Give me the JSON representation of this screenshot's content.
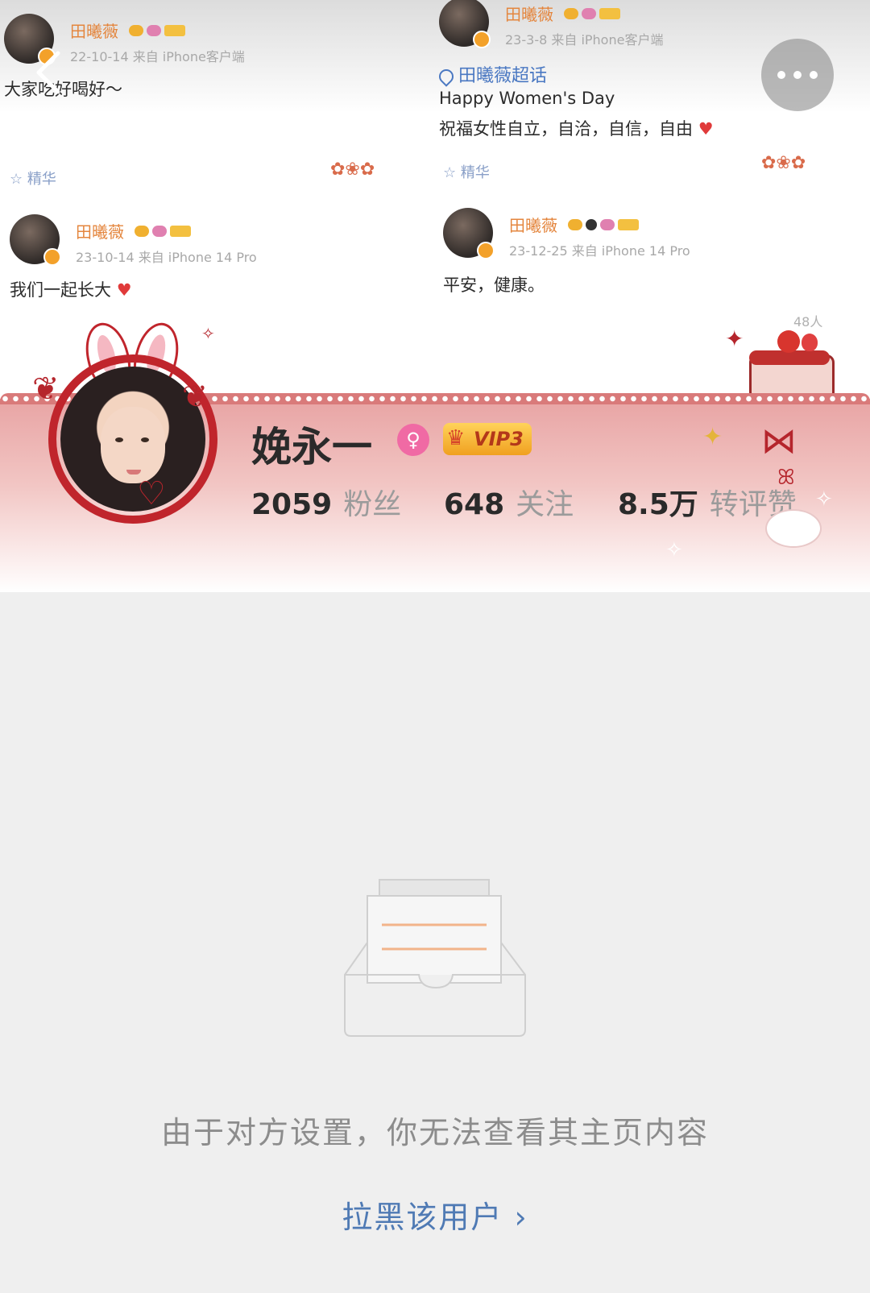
{
  "cover_posts": [
    {
      "name": "田曦薇",
      "meta": "22-10-14  来自 iPhone客户端",
      "text": "大家吃好喝好～",
      "tag": "精华"
    },
    {
      "name": "田曦薇",
      "meta": "23-3-8  来自 iPhone客户端",
      "topic": "田曦薇超话",
      "text_line1": "Happy Women's Day",
      "text_line2": "祝福女性自立，自洽，自信，自由",
      "tag": "精华"
    },
    {
      "name": "田曦薇",
      "meta": "23-10-14  来自 iPhone 14 Pro",
      "text": "我们一起长大"
    },
    {
      "name": "田曦薇",
      "meta": "23-12-25  来自 iPhone 14 Pro",
      "text": "平安，健康。",
      "extra": "48人"
    }
  ],
  "profile": {
    "username": "娩永一",
    "gender_symbol": "♀",
    "vip_label": "VIP3",
    "stats": [
      {
        "value": "2059",
        "label": "粉丝"
      },
      {
        "value": "648",
        "label": "关注"
      },
      {
        "value": "8.5万",
        "label": "转评赞"
      }
    ]
  },
  "empty_state": {
    "message": "由于对方设置，你无法查看其主页内容",
    "block_link": "拉黑该用户 ›"
  },
  "colors": {
    "band_pink": "#e8a4a4",
    "link_blue": "#4f7ab4",
    "name_orange": "#e4863e",
    "vip_gold": "#ffd35a"
  }
}
